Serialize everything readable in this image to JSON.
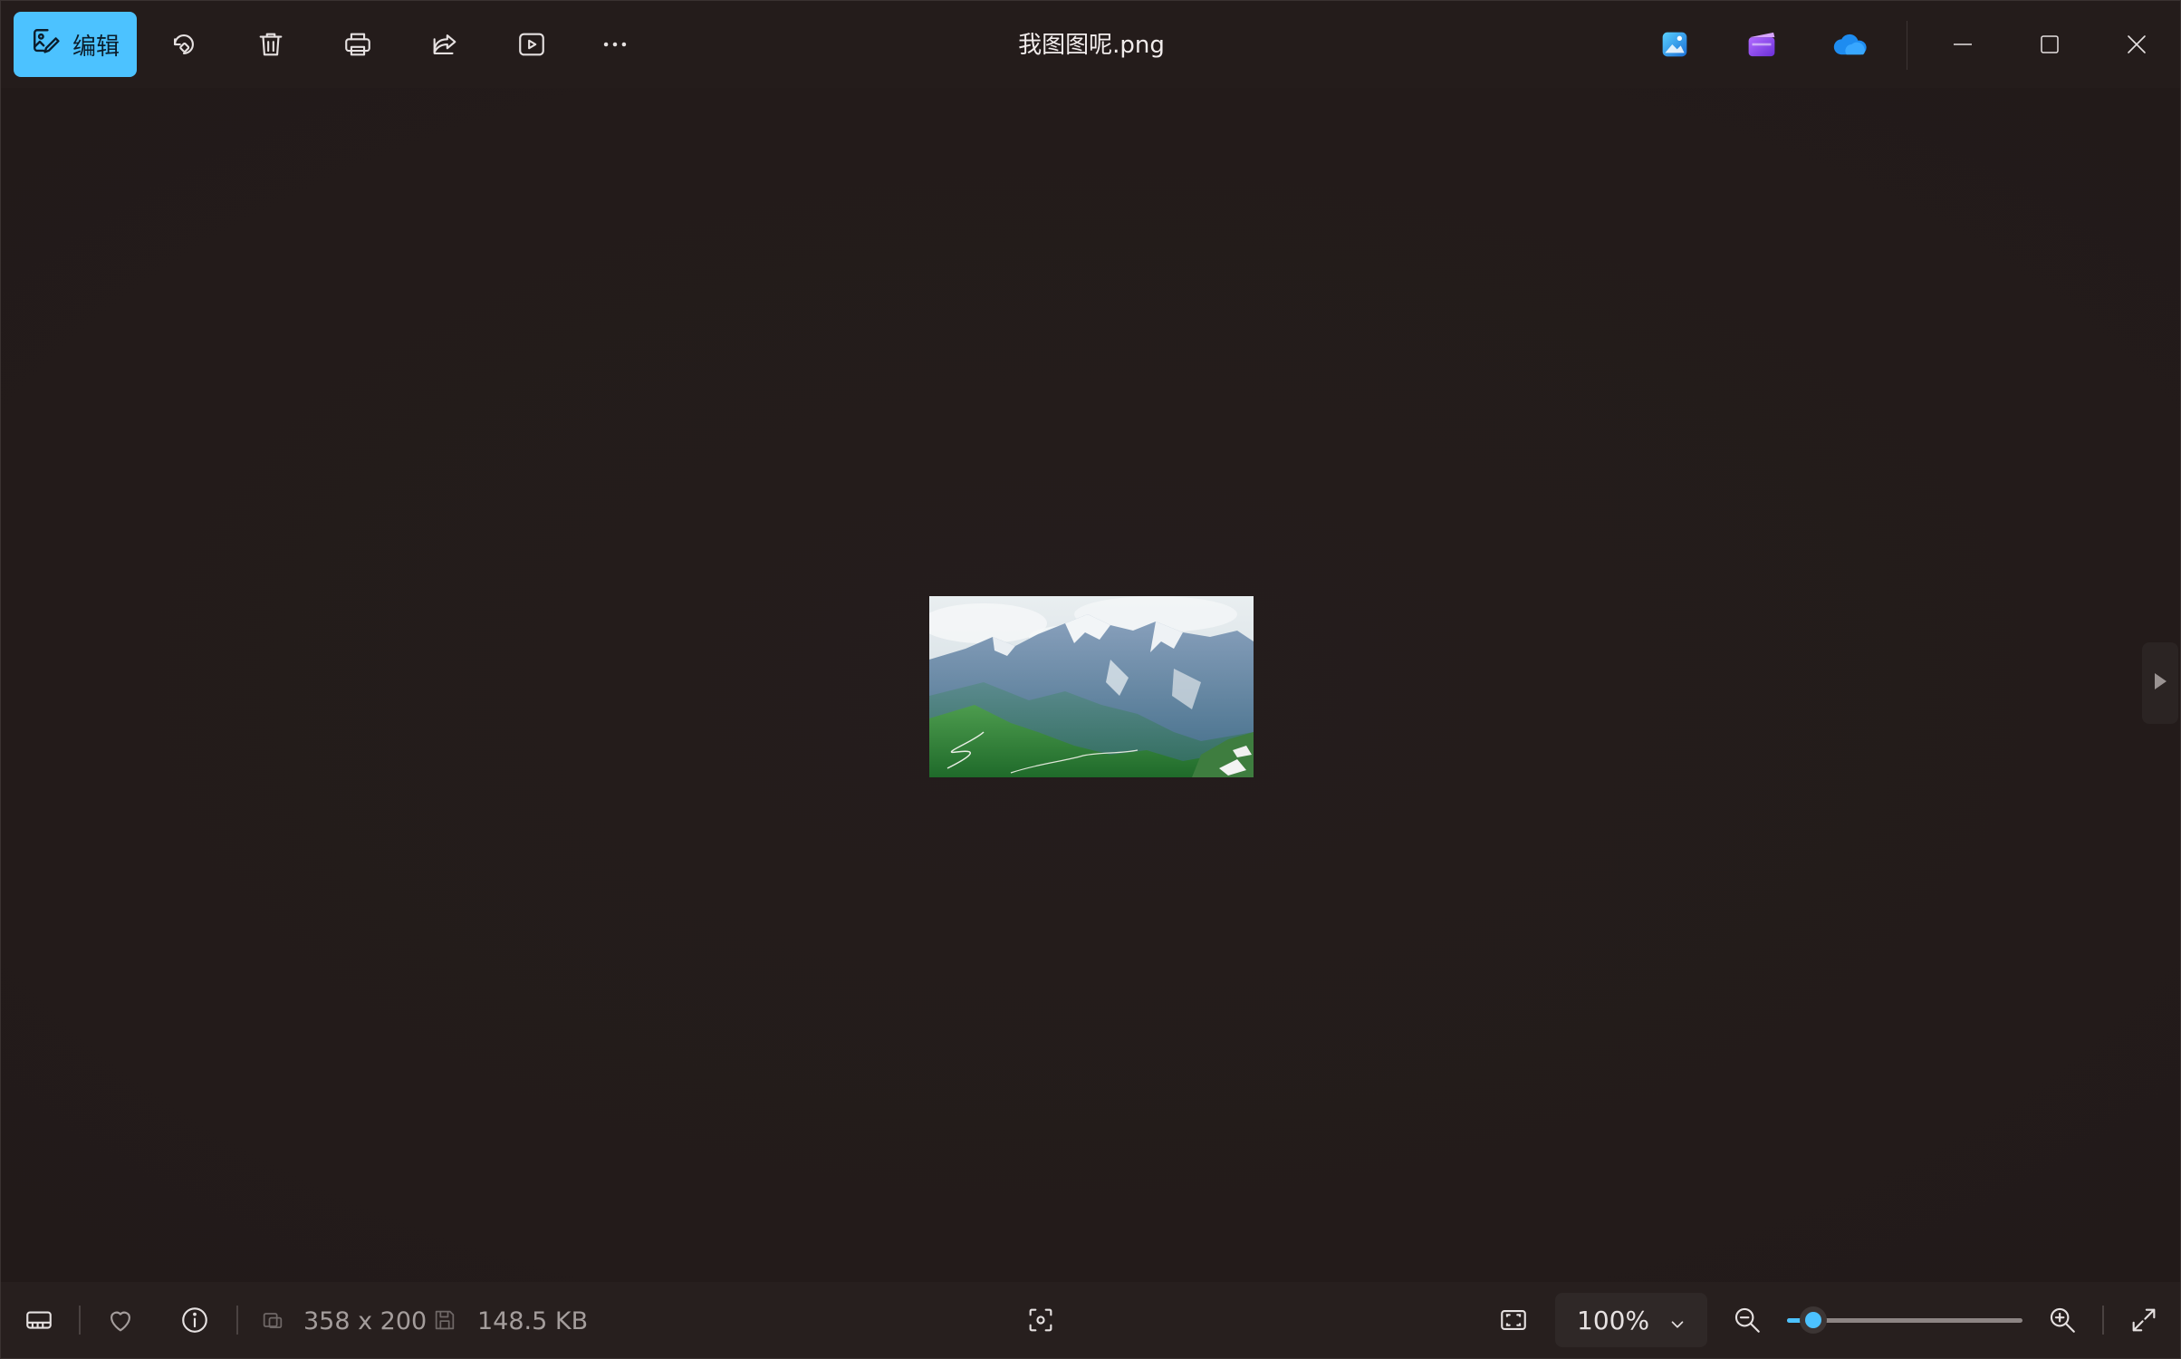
{
  "toolbar": {
    "edit_label": "编辑",
    "icons": [
      "edit-image-icon",
      "rotate-icon",
      "delete-icon",
      "print-icon",
      "share-icon",
      "slideshow-icon",
      "more-icon"
    ]
  },
  "window": {
    "title": "我图图呢.png",
    "app_icons": [
      "photos-app-icon",
      "clipchamp-icon",
      "onedrive-icon"
    ],
    "controls": [
      "minimize-icon",
      "maximize-icon",
      "close-icon"
    ]
  },
  "viewer": {
    "image_description_icon": "mountain-photo",
    "next_icon": "next-arrow-icon"
  },
  "statusbar": {
    "dimensions": "358 x 200",
    "file_size": "148.5 KB",
    "zoom_value": "100%",
    "zoom_level_fraction": 0.11
  },
  "colors": {
    "accent": "#4cc2ff",
    "background": "#241c1b",
    "statusbar": "#271f1e"
  }
}
